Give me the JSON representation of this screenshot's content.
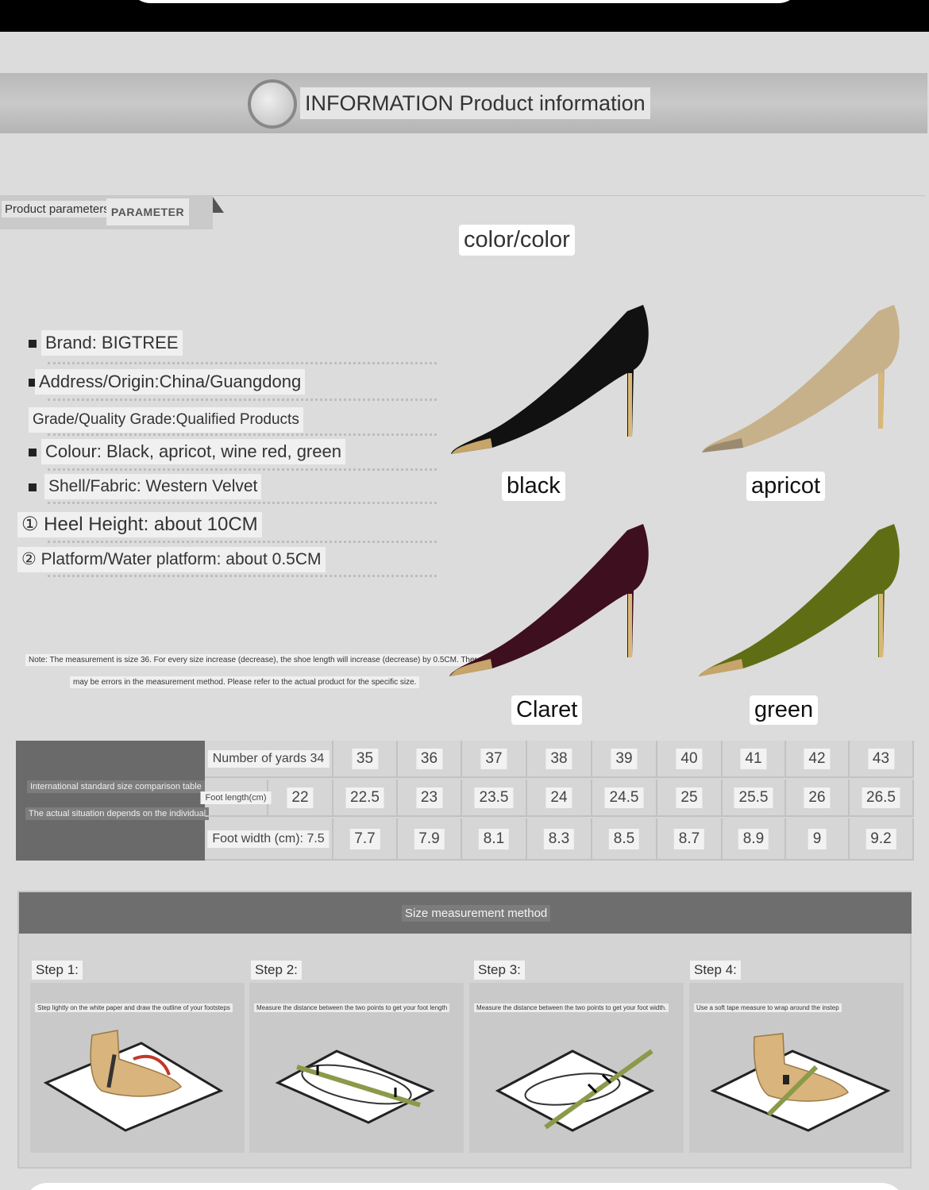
{
  "banner": {
    "title": "INFORMATION Product information"
  },
  "parameter_tab": {
    "label": "Product parameters",
    "english": "PARAMETER"
  },
  "specs": [
    {
      "text": "Brand: BIGTREE"
    },
    {
      "text": "Address/Origin:China/Guangdong"
    },
    {
      "text": "Grade/Quality Grade:Qualified Products"
    },
    {
      "text": "Colour: Black, apricot, wine red, green"
    },
    {
      "text": "Shell/Fabric: Western Velvet"
    },
    {
      "text": "① Heel Height: about 10CM"
    },
    {
      "text": "② Platform/Water platform: about 0.5CM"
    }
  ],
  "note": {
    "line1": "Note: The measurement is size 36. For every size increase (decrease), the shoe length will increase (decrease) by 0.5CM. There",
    "line2": "may be errors in the measurement method. Please refer to the actual product for the specific size."
  },
  "colors": {
    "title": "color/color",
    "items": [
      {
        "label": "black",
        "color": "#111111"
      },
      {
        "label": "apricot",
        "color": "#c7b18a"
      },
      {
        "label": "Claret",
        "color": "#3e0f1e"
      },
      {
        "label": "green",
        "color": "#5f6e14"
      }
    ]
  },
  "size_table": {
    "head_line1": "International standard size comparison table",
    "head_line2": "The actual situation depends on the individual",
    "row_labels": [
      "Number of yards 34",
      "Foot length(cm)",
      "Foot width (cm): 7.5"
    ],
    "sizes": [
      "35",
      "36",
      "37",
      "38",
      "39",
      "40",
      "41",
      "42",
      "43"
    ],
    "foot_length": [
      "22",
      "22.5",
      "23",
      "23.5",
      "24",
      "24.5",
      "25",
      "25.5",
      "26",
      "26.5"
    ],
    "foot_width": [
      "7.7",
      "7.9",
      "8.1",
      "8.3",
      "8.5",
      "8.7",
      "8.9",
      "9",
      "9.2"
    ]
  },
  "measurement": {
    "title": "Size measurement method",
    "steps": [
      {
        "title": "Step 1:",
        "caption": "Step lightly on the white paper and draw the outline of your footsteps"
      },
      {
        "title": "Step 2:",
        "caption": "Measure the distance between the two points to get your foot length"
      },
      {
        "title": "Step 3:",
        "caption": "Measure the distance between the two points to get your foot width."
      },
      {
        "title": "Step 4:",
        "caption": "Use a soft tape measure to wrap around the instep"
      }
    ]
  }
}
